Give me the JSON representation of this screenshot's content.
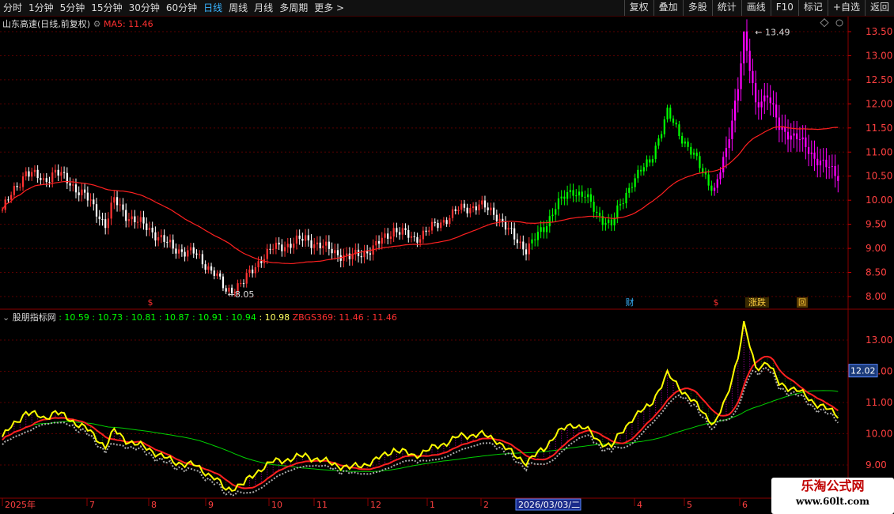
{
  "toolbar": {
    "periods": [
      "分时",
      "1分钟",
      "5分钟",
      "15分钟",
      "30分钟",
      "60分钟",
      "日线",
      "周线",
      "月线",
      "多周期",
      "更多 >"
    ],
    "active_period": "日线",
    "buttons": [
      "复权",
      "叠加",
      "多股",
      "统计",
      "画线",
      "F10",
      "标记",
      "+自选",
      "返回"
    ]
  },
  "main_panel": {
    "stock_title": "山东高速(日线,前复权)",
    "ma_label": "MA5: 11.46",
    "high_label": "13.49",
    "low_label": "8.05",
    "y_ticks": [
      "13.50",
      "13.00",
      "12.50",
      "12.00",
      "11.50",
      "11.00",
      "10.50",
      "10.00",
      "9.50",
      "9.00",
      "8.50",
      "8.00"
    ],
    "markers": {
      "dollar": "$",
      "cai": "财",
      "jiang_die": "涨跌",
      "square": "回"
    }
  },
  "indicator_panel": {
    "name": "股朋指标网",
    "values": [
      ": 10.59",
      ": 10.73",
      ": 10.81",
      ": 10.87",
      ": 10.91",
      ": 10.94",
      ": 10.98"
    ],
    "zbgs_label": "ZBGS369: 11.46",
    "zbgs_value": ": 11.46",
    "y_ticks": [
      "13.00",
      "12.00",
      "11.00",
      "10.00",
      "9.00"
    ],
    "cursor_value": "12.02"
  },
  "time_axis": {
    "labels": [
      "2025年",
      "7",
      "8",
      "9",
      "10",
      "11",
      "12",
      "1",
      "2",
      "3",
      "4",
      "5",
      "6",
      "7"
    ],
    "selected_date": "2026/03/03/二"
  },
  "watermark": {
    "line1": "乐淘公式网",
    "line2": "www.60lt.com"
  },
  "colors": {
    "up": "#ff3232",
    "down": "#ffffff",
    "trend_up": "#00ff00",
    "trend_hot": "#ff00ff",
    "ma": "#ff2020",
    "yellow": "#ffff00",
    "green_line": "#00d000",
    "axis": "#8b0000"
  },
  "chart_data": {
    "type": "candlestick",
    "anchors": [
      [
        0,
        9.8
      ],
      [
        8,
        10.6
      ],
      [
        14,
        10.4
      ],
      [
        18,
        10.6
      ],
      [
        24,
        10.3
      ],
      [
        28,
        10.1
      ],
      [
        35,
        9.5
      ],
      [
        38,
        10.0
      ],
      [
        42,
        9.7
      ],
      [
        50,
        9.4
      ],
      [
        58,
        9.0
      ],
      [
        65,
        8.9
      ],
      [
        72,
        8.5
      ],
      [
        76,
        8.1
      ],
      [
        82,
        8.3
      ],
      [
        88,
        8.8
      ],
      [
        92,
        9.0
      ],
      [
        98,
        9.1
      ],
      [
        103,
        9.2
      ],
      [
        110,
        9.0
      ],
      [
        118,
        8.8
      ],
      [
        126,
        9.0
      ],
      [
        133,
        9.4
      ],
      [
        140,
        9.2
      ],
      [
        148,
        9.5
      ],
      [
        155,
        9.8
      ],
      [
        162,
        9.9
      ],
      [
        168,
        9.7
      ],
      [
        174,
        9.2
      ],
      [
        178,
        9.0
      ],
      [
        184,
        9.4
      ],
      [
        188,
        9.9
      ],
      [
        194,
        10.2
      ],
      [
        198,
        10.1
      ],
      [
        202,
        9.7
      ],
      [
        207,
        9.5
      ],
      [
        214,
        10.4
      ],
      [
        220,
        10.8
      ],
      [
        226,
        11.8
      ],
      [
        230,
        11.4
      ],
      [
        236,
        10.8
      ],
      [
        242,
        10.2
      ],
      [
        246,
        11.0
      ],
      [
        250,
        12.4
      ],
      [
        252,
        13.4
      ],
      [
        256,
        12.0
      ],
      [
        260,
        12.2
      ],
      [
        264,
        11.5
      ],
      [
        270,
        11.3
      ],
      [
        276,
        10.9
      ],
      [
        280,
        10.7
      ],
      [
        284,
        10.5
      ]
    ],
    "high": 13.49,
    "low": 8.05,
    "ma_last": 11.46,
    "indicator_last": 11.46
  }
}
